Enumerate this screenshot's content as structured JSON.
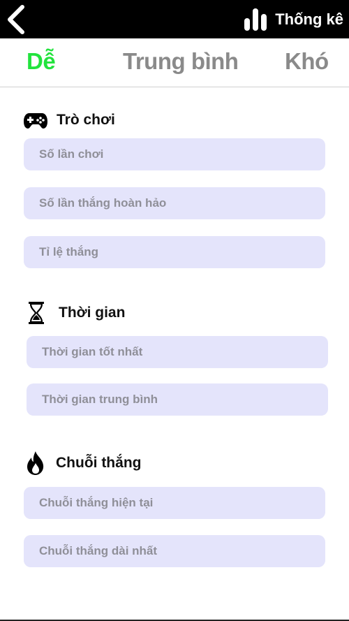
{
  "header": {
    "back_icon": "chevron-left-icon",
    "stats_icon": "bar-chart-icon",
    "stats_label": "Thống kê"
  },
  "tabs": [
    {
      "label": "Dễ",
      "active": true
    },
    {
      "label": "Trung bình",
      "active": false
    },
    {
      "label": "Khó",
      "active": false
    }
  ],
  "colors": {
    "active_tab": "#22e33d",
    "inactive_tab": "#8a8a8a",
    "row_background": "#e4e4fb",
    "row_text": "#8f8f98"
  },
  "sections": [
    {
      "title": "Trò chơi",
      "icon": "gamepad-icon",
      "rows": [
        "Số lần chơi",
        "Số lần thắng hoàn hảo",
        "Tỉ lệ thắng"
      ]
    },
    {
      "title": "Thời gian",
      "icon": "hourglass-icon",
      "rows": [
        "Thời gian tốt nhất",
        "Thời gian trung bình"
      ]
    },
    {
      "title": "Chuỗi thắng",
      "icon": "flame-icon",
      "rows": [
        "Chuỗi thắng hiện tại",
        "Chuỗi thắng dài nhất"
      ]
    }
  ]
}
